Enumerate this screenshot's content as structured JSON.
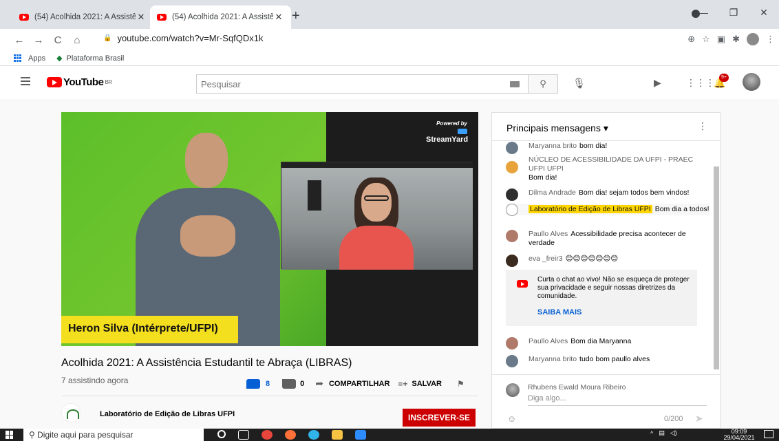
{
  "browser": {
    "tabs": [
      {
        "title": "(54) Acolhida 2021: A Assistência",
        "close": "✕"
      },
      {
        "title": "(54) Acolhida 2021: A Assistência",
        "close": "✕"
      }
    ],
    "new_tab": "+",
    "window_buttons": [
      "—",
      "❐",
      "✕"
    ],
    "url": "youtube.com/watch?v=Mr-SqfQDx1k",
    "bookmarks": [
      {
        "label": "Apps",
        "icon": "apps-grid-icon"
      },
      {
        "label": "Plataforma Brasil",
        "icon": "bookmark-icon"
      }
    ]
  },
  "youtube": {
    "logo_text": "YouTube",
    "region": "BR",
    "search_placeholder": "Pesquisar",
    "notification_count": "9+"
  },
  "video": {
    "overlay_powered_by": "Powered by",
    "overlay_brand": "StreamYard",
    "lower_third_name": "Heron Silva (Intérprete/UFPI)",
    "title": "Acolhida 2021: A Assistência Estudantil te Abraça (LIBRAS)",
    "viewers": "7 assistindo agora",
    "likes": "8",
    "dislikes": "0",
    "share_label": "COMPARTILHAR",
    "save_label": "SALVAR"
  },
  "channel": {
    "name": "Laboratório de Edição de Libras UFPI",
    "subscribe_label": "INSCREVER-SE"
  },
  "chat": {
    "header": "Principais mensagens",
    "messages": [
      {
        "author": "Maryanna brito",
        "text": "bom dia!",
        "avatar_color": "#6b7a8a"
      },
      {
        "author": "NÚCLEO DE ACESSIBILIDADE DA UFPI - PRAEC UFPI UFPI",
        "text": "Bom dia!",
        "avatar_color": "#e8a33a"
      },
      {
        "author": "Dilma Andrade",
        "text": "Bom dia! sejam todos bem vindos!",
        "avatar_color": "#2f2f2f"
      },
      {
        "author": "Laboratório de Edição de Libras UFPI",
        "text": "Bom dia a todos!",
        "avatar_color": "#ffffff"
      },
      {
        "author": "Paullo Alves",
        "text": "Acessibilidade precisa acontecer de verdade",
        "avatar_color": "#b07a6a"
      },
      {
        "author": "eva _freir3",
        "text": "😊😊😊😊😊😊😊",
        "avatar_color": "#3a2a20"
      },
      {
        "author": "Paullo Alves",
        "text": "Bom dia Maryanna",
        "avatar_color": "#b07a6a"
      },
      {
        "author": "Maryanna brito",
        "text": "tudo bom paullo alves",
        "avatar_color": "#6b7a8a"
      }
    ],
    "notice_text": "Curta o chat ao vivo! Não se esqueça de proteger sua privacidade e seguir nossas diretrizes da comunidade.",
    "notice_link": "SAIBA MAIS",
    "input_user": "Rhubens Ewald Moura Ribeiro",
    "input_placeholder": "Diga algo...",
    "char_count": "0/200"
  },
  "taskbar": {
    "search_placeholder": "Digite aqui para pesquisar",
    "time": "09:09",
    "date": "29/04/2021"
  }
}
